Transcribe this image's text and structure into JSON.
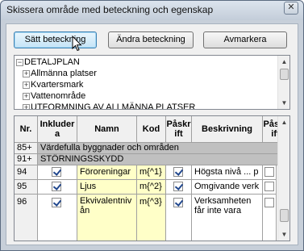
{
  "window": {
    "title": "Skissera område med beteckning och egenskap",
    "close_glyph": "✕"
  },
  "toolbar": {
    "set_label": "Sätt beteckning",
    "change_label": "Ändra beteckning",
    "deselect_label": "Avmarkera"
  },
  "tree": {
    "items": [
      {
        "label": "DETALJPLAN",
        "toggle": "−"
      },
      {
        "label": "Allmänna platser",
        "toggle": "+"
      },
      {
        "label": "Kvartersmark",
        "toggle": "+"
      },
      {
        "label": "Vattenområde",
        "toggle": "+"
      },
      {
        "label": "UTFORMNING AV ALLMÄNNA PLATSER",
        "toggle": "+"
      }
    ]
  },
  "table": {
    "columns": [
      "Nr.",
      "Inkludera",
      "Namn",
      "Kod",
      "Påskrift",
      "Beskrivning",
      "Påskrift"
    ],
    "groups": [
      {
        "nr": "85+",
        "label": "Värdefulla byggnader och områden"
      },
      {
        "nr": "91+",
        "label": "STÖRNINGSSKYDD"
      }
    ],
    "rows": [
      {
        "nr": "94",
        "include": true,
        "name": "Föroreningar",
        "code": "m{^1}",
        "label1": true,
        "description": "Högsta nivå ... p",
        "label2": false
      },
      {
        "nr": "95",
        "include": true,
        "name": "Ljus",
        "code": "m{^2}",
        "label1": true,
        "description": "Omgivande verk",
        "label2": false
      },
      {
        "nr": "96",
        "include": true,
        "name": "Ekvivalentnivån",
        "code": "m{^3}",
        "label1": true,
        "description": "Verksamheten får inte vara",
        "label2": false
      }
    ]
  }
}
